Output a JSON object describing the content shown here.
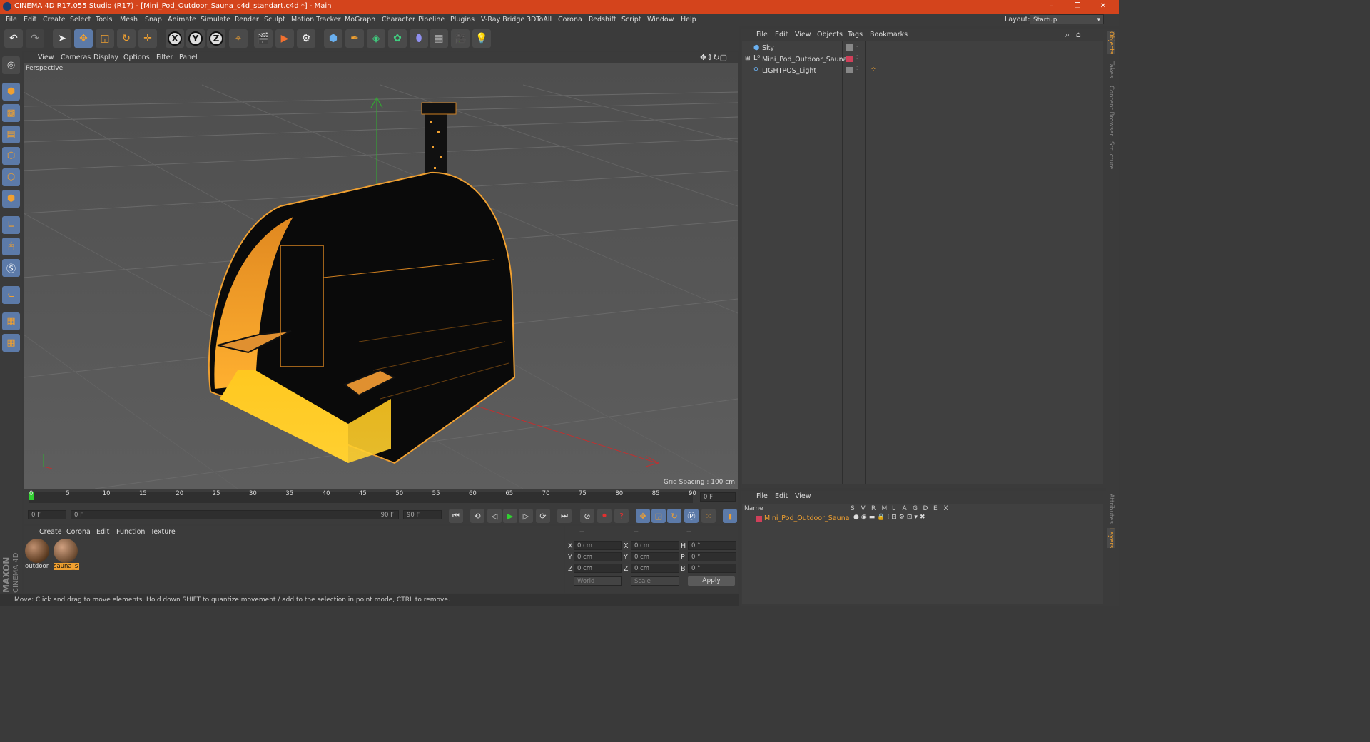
{
  "window": {
    "title": "CINEMA 4D R17.055 Studio (R17) - [Mini_Pod_Outdoor_Sauna_c4d_standart.c4d *] - Main",
    "controls": [
      "–",
      "❐",
      "✕"
    ]
  },
  "menubar": {
    "items": [
      "File",
      "Edit",
      "Create",
      "Select",
      "Tools",
      "Mesh",
      "Snap",
      "Animate",
      "Simulate",
      "Render",
      "Sculpt",
      "Motion Tracker",
      "MoGraph",
      "Character",
      "Pipeline",
      "Plugins",
      "V-Ray Bridge",
      "3DToAll",
      "Corona",
      "Redshift",
      "Script",
      "Window",
      "Help"
    ],
    "layout_label": "Layout:",
    "layout_value": "Startup"
  },
  "toolbar": {
    "icons": [
      "undo-icon",
      "redo-icon",
      "select-arrow-icon",
      "move-icon",
      "scale-icon",
      "rotate-icon",
      "transform-icon",
      "x-axis-icon",
      "y-axis-icon",
      "z-axis-icon",
      "world-coord-icon",
      "render-view-icon",
      "render-picture-viewer-icon",
      "edit-render-settings-icon",
      "cube-icon",
      "pen-icon",
      "subdivision-icon",
      "array-icon",
      "deformer-icon",
      "floor-icon",
      "camera-icon",
      "light-icon"
    ],
    "axis_labels": [
      "X",
      "Y",
      "Z"
    ]
  },
  "viewport": {
    "menu": [
      "View",
      "Cameras",
      "Display",
      "Options",
      "Filter",
      "Panel"
    ],
    "label": "Perspective",
    "grid_spacing": "Grid Spacing : 100 cm"
  },
  "timeline": {
    "ticks": [
      "0",
      "5",
      "10",
      "15",
      "20",
      "25",
      "30",
      "35",
      "40",
      "45",
      "50",
      "55",
      "60",
      "65",
      "70",
      "75",
      "80",
      "85",
      "90"
    ],
    "current_frame_field": "0 F"
  },
  "playbar": {
    "start": "0 F",
    "range_start": "0 F",
    "range_end": "90 F",
    "end": "90 F"
  },
  "materials": {
    "menu": [
      "Create",
      "Corona",
      "Edit",
      "Function",
      "Texture"
    ],
    "items": [
      {
        "label": "outdoor",
        "selected": false
      },
      {
        "label": "sauna_s",
        "selected": true
      }
    ]
  },
  "coordinates": {
    "headers": [
      "--",
      "--",
      "--"
    ],
    "rows": [
      {
        "a": "X",
        "v1": "0 cm",
        "b": "X",
        "v2": "0 cm",
        "c": "H",
        "v3": "0 °"
      },
      {
        "a": "Y",
        "v1": "0 cm",
        "b": "Y",
        "v2": "0 cm",
        "c": "P",
        "v3": "0 °"
      },
      {
        "a": "Z",
        "v1": "0 cm",
        "b": "Z",
        "v2": "0 cm",
        "c": "B",
        "v3": "0 °"
      }
    ],
    "mode1": "World",
    "mode2": "Scale",
    "apply": "Apply"
  },
  "status": {
    "text": "Move: Click and drag to move elements. Hold down SHIFT to quantize movement / add to the selection in point mode, CTRL to remove."
  },
  "objects_panel": {
    "menu": [
      "File",
      "Edit",
      "View",
      "Objects",
      "Tags",
      "Bookmarks"
    ],
    "objects": [
      {
        "name": "Sky",
        "icon": "sky-icon"
      },
      {
        "name": "Mini_Pod_Outdoor_Sauna",
        "icon": "null-object-icon"
      },
      {
        "name": "LIGHTPOS_Light",
        "icon": "light-icon"
      }
    ]
  },
  "layers_panel": {
    "menu": [
      "File",
      "Edit",
      "View"
    ],
    "header_name": "Name",
    "header_flags": [
      "S",
      "V",
      "R",
      "M",
      "L",
      "A",
      "G",
      "D",
      "E",
      "X"
    ],
    "layers": [
      {
        "name": "Mini_Pod_Outdoor_Sauna",
        "color": "#d0405a"
      }
    ]
  },
  "right_tabs": {
    "top": [
      "Objects",
      "Takes",
      "Content Browser",
      "Structure"
    ],
    "bottom": [
      "Attributes",
      "Layers"
    ]
  },
  "branding": {
    "text1": "MAXON",
    "text2": "CINEMA 4D"
  }
}
